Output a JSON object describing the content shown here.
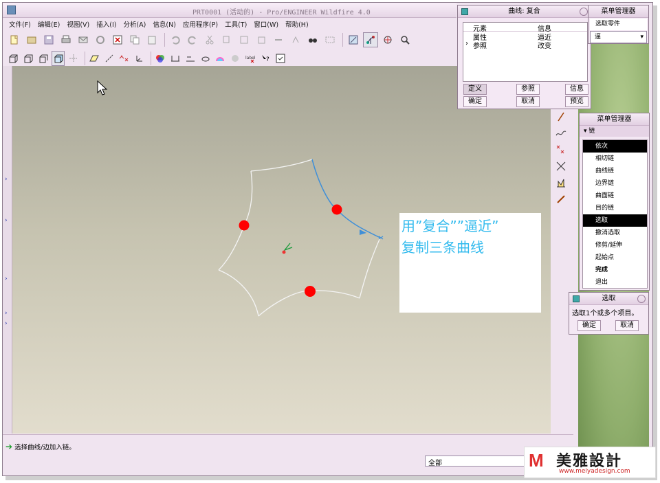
{
  "window": {
    "title": "PRT0001 (活动的) - Pro/ENGINEER Wildfire 4.0"
  },
  "menubar": {
    "items": [
      "文件(F)",
      "编辑(E)",
      "视图(V)",
      "插入(I)",
      "分析(A)",
      "信息(N)",
      "应用程序(P)",
      "工具(T)",
      "窗口(W)",
      "帮助(H)"
    ]
  },
  "annotation": {
    "line1": "用”复合””逼近”",
    "line2": "复制三条曲线"
  },
  "curve_dialog": {
    "title": "曲线: 复合",
    "col_element": "元素",
    "col_info": "信息",
    "rows": [
      {
        "element": "属性",
        "info": "逼近"
      },
      {
        "element": "参照",
        "info": "改变"
      }
    ],
    "buttons": {
      "define": "定义",
      "reference": "参照",
      "info": "信息",
      "ok": "确定",
      "cancel": "取消",
      "preview": "预览"
    }
  },
  "menu_manager_top": {
    "title": "菜单管理器",
    "item1": "选取零件",
    "select_value": "逼"
  },
  "menu_manager_chain": {
    "title": "菜单管理器",
    "section": "链",
    "items": [
      "依次",
      "相切链",
      "曲线链",
      "边界链",
      "曲面链",
      "目的链",
      "选取",
      "撤消选取",
      "修剪/延伸",
      "起始点",
      "完成",
      "退出"
    ],
    "highlighted": [
      "依次",
      "选取"
    ],
    "bold": [
      "完成"
    ]
  },
  "select_dialog": {
    "title": "选取",
    "prompt": "选取1个或多个项目。",
    "ok": "确定",
    "cancel": "取消"
  },
  "status": {
    "message": "选择曲线/边加入链。",
    "filter": "全部"
  },
  "logo": {
    "mark": "M",
    "name": "美雅設計",
    "url": "www.meiyadesign.com"
  },
  "colors": {
    "accent_cyan": "#33bbee",
    "point_red": "#ff0000",
    "curve_selected": "#3f8fd8"
  }
}
